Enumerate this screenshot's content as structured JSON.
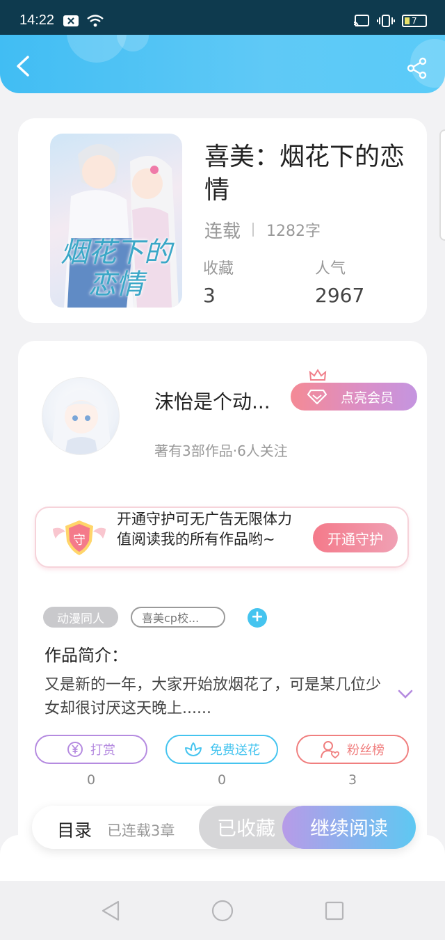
{
  "status_bar": {
    "time": "14:22",
    "battery": "7"
  },
  "book": {
    "cover_title": "烟花下的恋情",
    "title": "喜美：烟花下的恋情",
    "status": "连载",
    "word_count": "1282字",
    "stats": [
      {
        "label": "收藏",
        "value": "3"
      },
      {
        "label": "人气",
        "value": "2967"
      }
    ]
  },
  "author": {
    "name": "沫怡是个动...",
    "vip_label": "点亮会员",
    "meta": "著有3部作品·6人关注"
  },
  "guard": {
    "shield_char": "守",
    "text": "开通守护可无广告无限体力值阅读我的所有作品哟~",
    "button": "开通守护"
  },
  "tags": [
    "动漫同人",
    "喜美cp校..."
  ],
  "intro": {
    "label": "作品简介：",
    "text": "又是新的一年，大家开始放烟花了，可是某几位少女却很讨厌这天晚上......"
  },
  "actions": [
    {
      "label": "打赏",
      "icon": "yen-coin-icon",
      "count": "0",
      "color": "#b58be0"
    },
    {
      "label": "免费送花",
      "icon": "flower-icon",
      "count": "0",
      "color": "#45c4ef"
    },
    {
      "label": "粉丝榜",
      "icon": "fan-user-icon",
      "count": "3",
      "color": "#f07f7f"
    }
  ],
  "bottom_bar": {
    "toc_label": "目录",
    "toc_meta": "已连载3章",
    "favorited_label": "已收藏",
    "continue_label": "继续阅读"
  },
  "colors": {
    "header_blue": "#41bdf3",
    "accent_cyan": "#45c4ef",
    "vip_pink": "#f48a95",
    "guard_red": "#f47a8a"
  }
}
